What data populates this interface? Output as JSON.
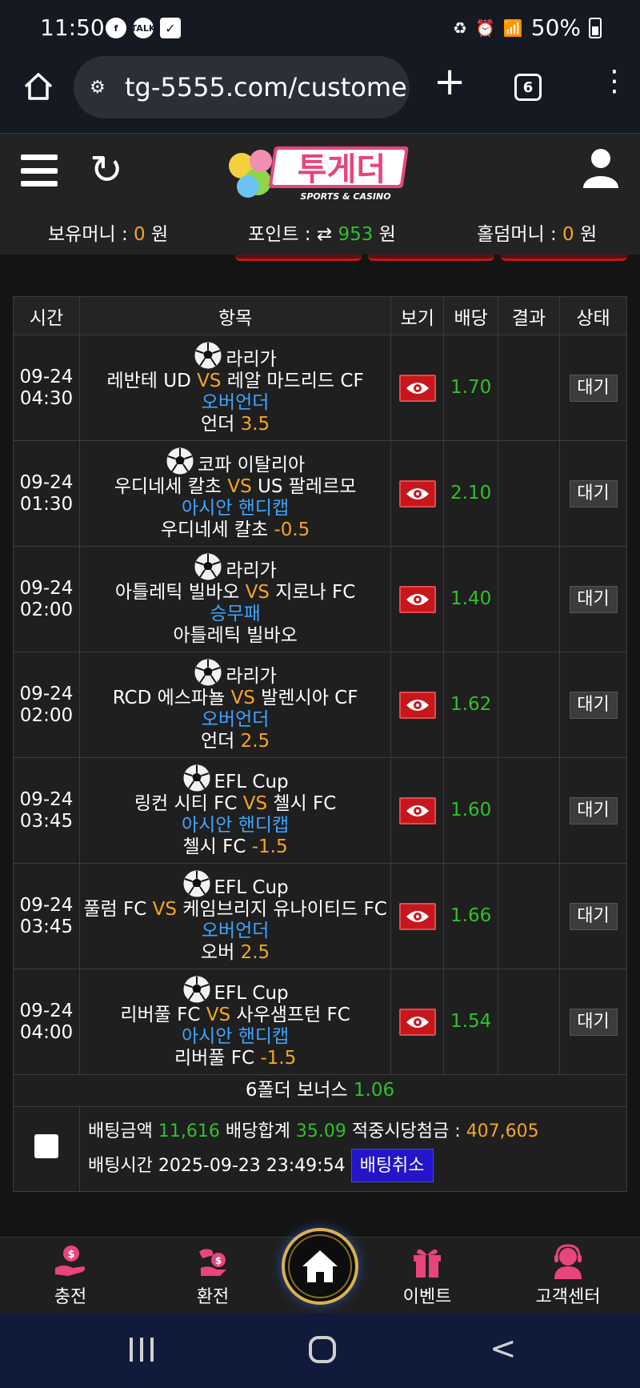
{
  "statusbar": {
    "time": "11:50",
    "battery": "50%"
  },
  "browser": {
    "url": "tg-5555.com/custome",
    "tab_count": "6"
  },
  "header": {
    "logo_text": "투게더",
    "logo_sub": "SPORTS & CASINO",
    "balance_label": "보유머니 : ",
    "balance_value": "0",
    "balance_unit": " 원",
    "point_label": "포인트 : ",
    "point_value": "953",
    "point_unit": " 원",
    "holdem_label": "홀덤머니 : ",
    "holdem_value": "0",
    "holdem_unit": " 원"
  },
  "table": {
    "headers": [
      "시간",
      "항목",
      "보기",
      "배당",
      "결과",
      "상태"
    ],
    "vs": "VS",
    "rows": [
      {
        "date": "09-24",
        "time": "04:30",
        "league": "라리가",
        "home": "레반테 UD",
        "away": "레알 마드리드 CF",
        "market": "오버언더",
        "pick": "언더",
        "line": "3.5",
        "odds": "1.70",
        "result": "",
        "status": "대기"
      },
      {
        "date": "09-24",
        "time": "01:30",
        "league": "코파 이탈리아",
        "home": "우디네세 칼초",
        "away": "US 팔레르모",
        "market": "아시안 핸디캡",
        "pick": "우디네세 칼초",
        "line": "-0.5",
        "odds": "2.10",
        "result": "",
        "status": "대기"
      },
      {
        "date": "09-24",
        "time": "02:00",
        "league": "라리가",
        "home": "아틀레틱 빌바오",
        "away": "지로나 FC",
        "market": "승무패",
        "pick": "아틀레틱 빌바오",
        "line": "",
        "odds": "1.40",
        "result": "",
        "status": "대기"
      },
      {
        "date": "09-24",
        "time": "02:00",
        "league": "라리가",
        "home": "RCD 에스파뇰",
        "away": "발렌시아 CF",
        "market": "오버언더",
        "pick": "언더",
        "line": "2.5",
        "odds": "1.62",
        "result": "",
        "status": "대기"
      },
      {
        "date": "09-24",
        "time": "03:45",
        "league": "EFL Cup",
        "home": "링컨 시티 FC",
        "away": "첼시 FC",
        "market": "아시안 핸디캡",
        "pick": "첼시 FC",
        "line": "-1.5",
        "odds": "1.60",
        "result": "",
        "status": "대기"
      },
      {
        "date": "09-24",
        "time": "03:45",
        "league": "EFL Cup",
        "home": "풀럼 FC",
        "away": "케임브리지 유나이티드 FC",
        "market": "오버언더",
        "pick": "오버",
        "line": "2.5",
        "odds": "1.66",
        "result": "",
        "status": "대기"
      },
      {
        "date": "09-24",
        "time": "04:00",
        "league": "EFL Cup",
        "home": "리버풀 FC",
        "away": "사우샘프턴 FC",
        "market": "아시안 핸디캡",
        "pick": "리버풀 FC",
        "line": "-1.5",
        "odds": "1.54",
        "result": "",
        "status": "대기"
      }
    ],
    "bonus_label": "6폴더 보너스 ",
    "bonus_value": "1.06",
    "summary": {
      "amount_label": "배팅금액 ",
      "amount_value": "11,616",
      "odds_label": " 배당합계 ",
      "odds_value": "35.09",
      "win_label": " 적중시당첨금 : ",
      "win_value": "407,605",
      "time_label": "배팅시간 ",
      "time_value": "2025-09-23 23:49:54",
      "cancel_label": "배팅취소"
    }
  },
  "bottom_nav": {
    "items": [
      {
        "label": "충전",
        "icon": "deposit-icon"
      },
      {
        "label": "환전",
        "icon": "exchange-icon"
      },
      {
        "label": "",
        "icon": "home-icon"
      },
      {
        "label": "이벤트",
        "icon": "gift-icon"
      },
      {
        "label": "고객센터",
        "icon": "support-icon"
      }
    ]
  },
  "colors": {
    "accent_orange": "#f5a623",
    "odds_green": "#2fc12a",
    "market_blue": "#3ea6ff",
    "eye_red": "#c8161d",
    "cancel_blue": "#2216c8"
  }
}
